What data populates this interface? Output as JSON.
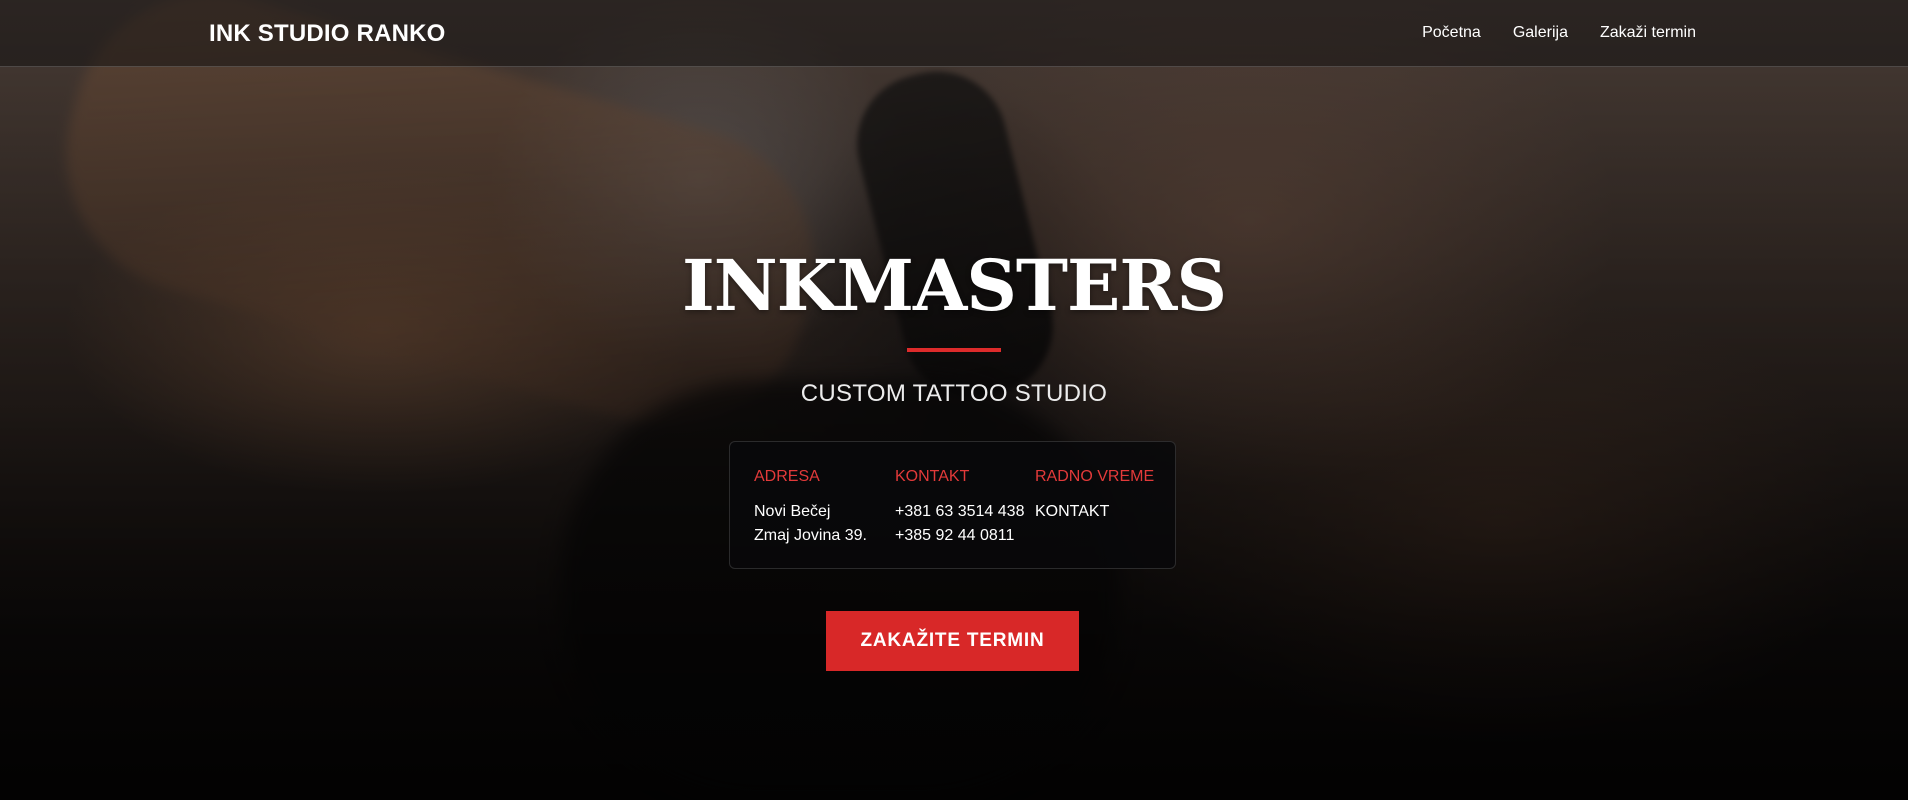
{
  "navbar": {
    "brand": "INK STUDIO RANKO",
    "links": [
      {
        "label": "Početna"
      },
      {
        "label": "Galerija"
      },
      {
        "label": "Zakaži termin"
      }
    ]
  },
  "hero": {
    "title": "INKMASTERS",
    "subtitle": "CUSTOM TATTOO STUDIO",
    "accent_color": "#dd2b2b",
    "info": {
      "address": {
        "heading": "ADRESA",
        "lines": [
          "Novi Bečej",
          "Zmaj Jovina 39."
        ]
      },
      "contact": {
        "heading": "KONTAKT",
        "lines": [
          "+381 63 3514 438",
          "+385 92 44 0811"
        ]
      },
      "hours": {
        "heading": "RADNO VREME",
        "lines": [
          "KONTAKT"
        ]
      }
    },
    "cta_label": "ZAKAŽITE TERMIN"
  }
}
